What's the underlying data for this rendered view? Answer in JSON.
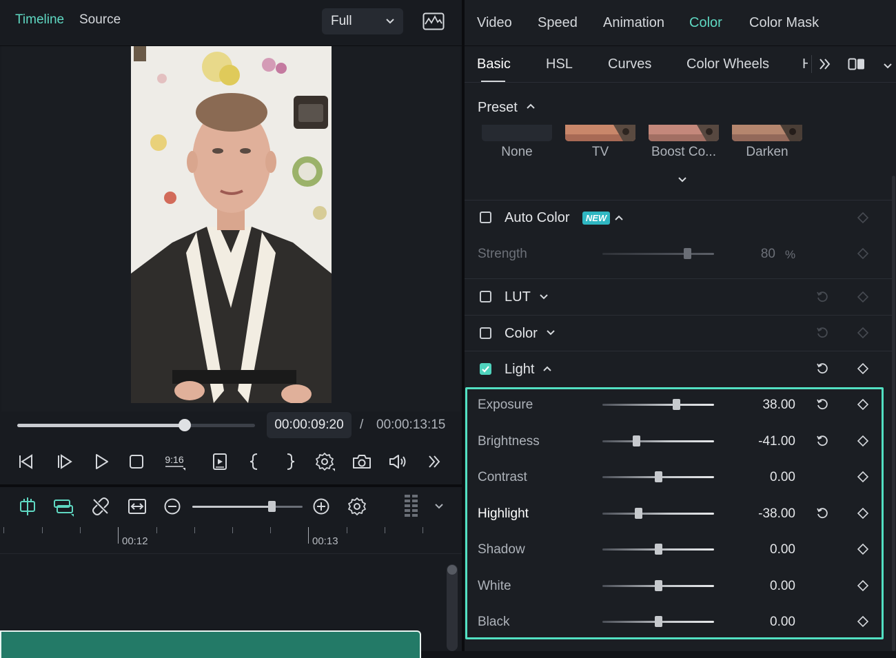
{
  "preview": {
    "tabs": [
      "Timeline",
      "Source"
    ],
    "active_tab": "Timeline",
    "quality": "Full",
    "time_current": "00:00:09:20",
    "time_separator": "/",
    "time_total": "00:00:13:15",
    "playhead_fraction": 0.7,
    "aspect_label": "9:16",
    "colors": {
      "accent": "#5fd8c2",
      "clip": "#237a67"
    }
  },
  "timeline": {
    "ruler_labels": [
      "00:12",
      "00:13"
    ],
    "zoom_fraction": 0.72
  },
  "inspector": {
    "main_tabs": [
      "Video",
      "Speed",
      "Animation",
      "Color",
      "Color Mask"
    ],
    "active_main_tab": "Color",
    "sub_tabs": [
      "Basic",
      "HSL",
      "Curves",
      "Color Wheels",
      "H"
    ],
    "active_sub_tab": "Basic",
    "preset": {
      "title": "Preset",
      "items": [
        "None",
        "TV",
        "Boost Co...",
        "Darken"
      ]
    },
    "auto_color": {
      "label": "Auto Color",
      "badge": "NEW",
      "checked": false,
      "strength_label": "Strength",
      "strength_value": "80",
      "strength_unit": "%",
      "strength_fraction": 0.76
    },
    "lut": {
      "label": "LUT",
      "checked": false
    },
    "color": {
      "label": "Color",
      "checked": false
    },
    "light": {
      "label": "Light",
      "checked": true,
      "params": [
        {
          "label": "Exposure",
          "value": "38.00",
          "fraction": 0.66,
          "reset": true
        },
        {
          "label": "Brightness",
          "value": "-41.00",
          "fraction": 0.3,
          "reset": true
        },
        {
          "label": "Contrast",
          "value": "0.00",
          "fraction": 0.5,
          "reset": false
        },
        {
          "label": "Highlight",
          "value": "-38.00",
          "fraction": 0.32,
          "reset": true
        },
        {
          "label": "Shadow",
          "value": "0.00",
          "fraction": 0.5,
          "reset": false
        },
        {
          "label": "White",
          "value": "0.00",
          "fraction": 0.5,
          "reset": false
        },
        {
          "label": "Black",
          "value": "0.00",
          "fraction": 0.5,
          "reset": false
        }
      ]
    }
  }
}
